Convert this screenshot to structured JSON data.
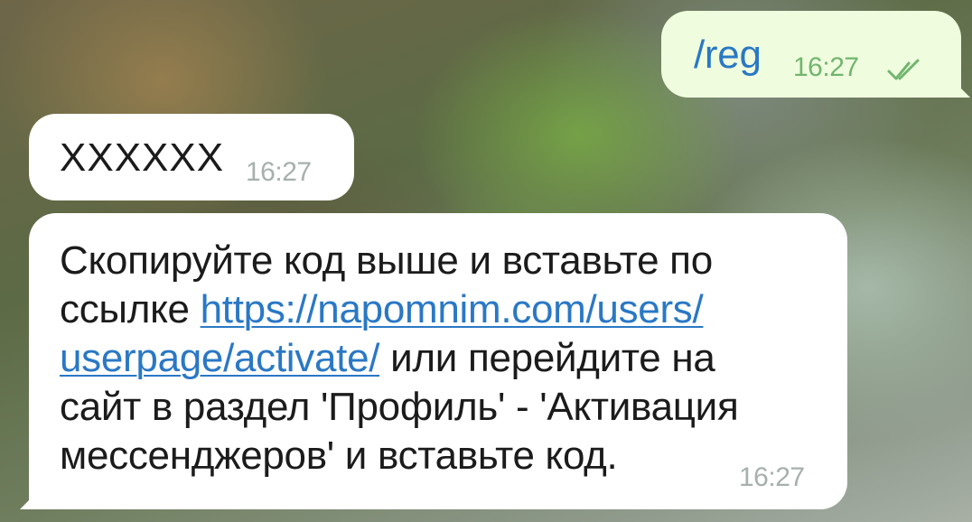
{
  "chat": {
    "outgoing": {
      "text": "/reg",
      "time": "16:27",
      "status_icon": "double-check-icon"
    },
    "incoming_code": {
      "text": "XXXXXX",
      "time": "16:27"
    },
    "incoming_info": {
      "line1": "Скопируйте код выше и вставьте по",
      "line2_prefix": "ссылке ",
      "link_part1": "https://napomnim.com/users/",
      "link_part2": "userpage/activate/",
      "line3_suffix": " или перейдите на",
      "line4": "сайт в раздел 'Профиль' - 'Активация",
      "line5": "мессенджеров' и вставьте код.",
      "time": "16:27"
    }
  },
  "colors": {
    "outgoing_bubble": "#effdde",
    "incoming_bubble": "#ffffff",
    "link": "#2a78c5",
    "outgoing_time": "#72b56f",
    "incoming_time": "#a7b0ad"
  }
}
